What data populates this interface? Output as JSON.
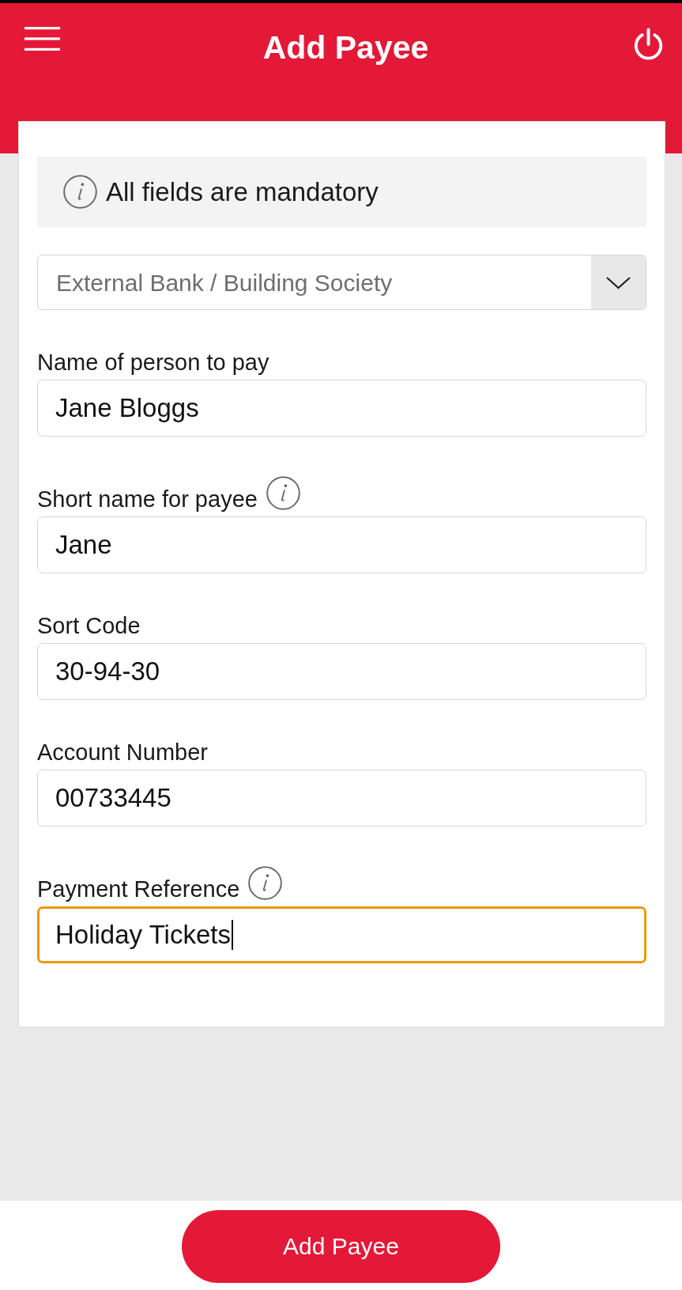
{
  "header": {
    "title": "Add Payee"
  },
  "notice": {
    "text": "All fields are mandatory"
  },
  "payee_type": {
    "value": "External Bank / Building Society"
  },
  "fields": [
    {
      "label": "Name of person to pay",
      "value": "Jane Bloggs",
      "info_icon": false,
      "focused": false
    },
    {
      "label": "Short name for payee",
      "value": "Jane",
      "info_icon": true,
      "focused": false
    },
    {
      "label": "Sort Code",
      "value": "30-94-30",
      "info_icon": false,
      "focused": false
    },
    {
      "label": "Account Number",
      "value": "00733445",
      "info_icon": false,
      "focused": false
    },
    {
      "label": "Payment Reference",
      "value": "Holiday Tickets",
      "info_icon": true,
      "focused": true
    }
  ],
  "footer": {
    "button": "Add Payee"
  }
}
